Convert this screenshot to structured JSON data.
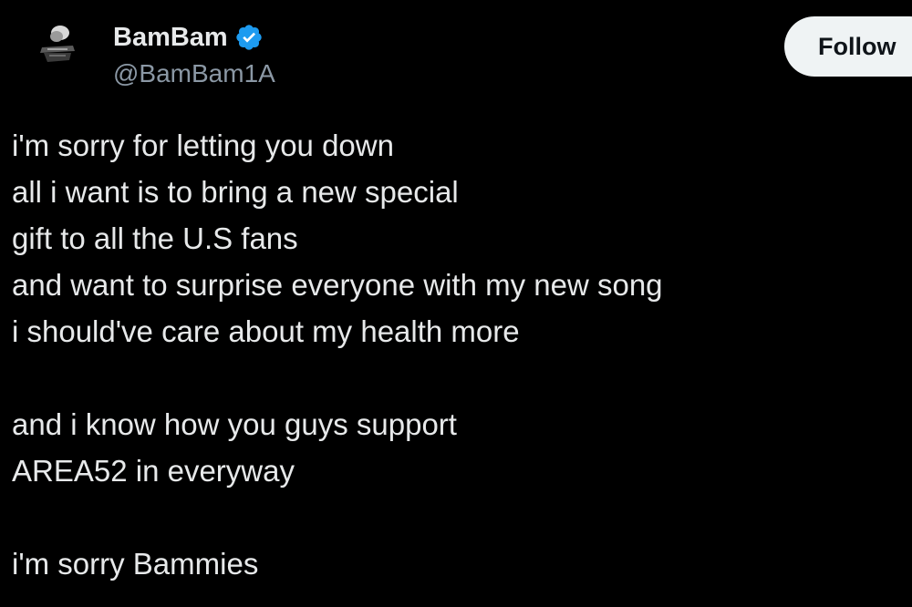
{
  "author": {
    "display_name": "BamBam",
    "handle": "@BamBam1A",
    "verified": true,
    "avatar_icon": "avatar-image",
    "verified_icon": "verified-badge-icon"
  },
  "follow_button": {
    "label": "Follow"
  },
  "tweet": {
    "lines": [
      "i'm sorry for letting you down",
      "all i want is to bring a new special",
      "gift to all the U.S fans",
      "and want to surprise everyone with my new song",
      "i should've care about my health more",
      "",
      "and i know how you guys support",
      "AREA52 in everyway",
      "",
      "i'm sorry Bammies"
    ]
  },
  "colors": {
    "background": "#000000",
    "text": "#e7e9ea",
    "secondary_text": "#8b98a5",
    "verified_blue": "#1d9bf0",
    "follow_bg": "#eff3f4"
  }
}
